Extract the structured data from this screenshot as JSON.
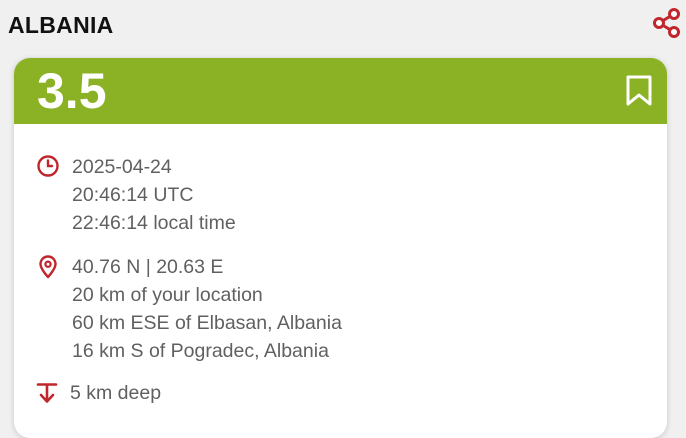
{
  "header": {
    "title": "ALBANIA",
    "share_icon": "share-icon"
  },
  "colors": {
    "accent": "#c0262c",
    "card_header": "#8bb124",
    "text_secondary": "#606060",
    "background": "#f0f0f0"
  },
  "event": {
    "magnitude": "3.5",
    "bookmark_icon": "bookmark-icon",
    "time": {
      "icon": "clock-icon",
      "date": "2025-04-24",
      "utc": "20:46:14 UTC",
      "local": "22:46:14 local time"
    },
    "location": {
      "icon": "location-pin-icon",
      "coordinates": "40.76 N | 20.63 E",
      "distance_from_user": "20 km of your location",
      "nearby_1": "60 km ESE of Elbasan, Albania",
      "nearby_2": "16 km S of Pogradec, Albania"
    },
    "depth": {
      "icon": "depth-arrow-icon",
      "value": "5 km deep"
    }
  }
}
